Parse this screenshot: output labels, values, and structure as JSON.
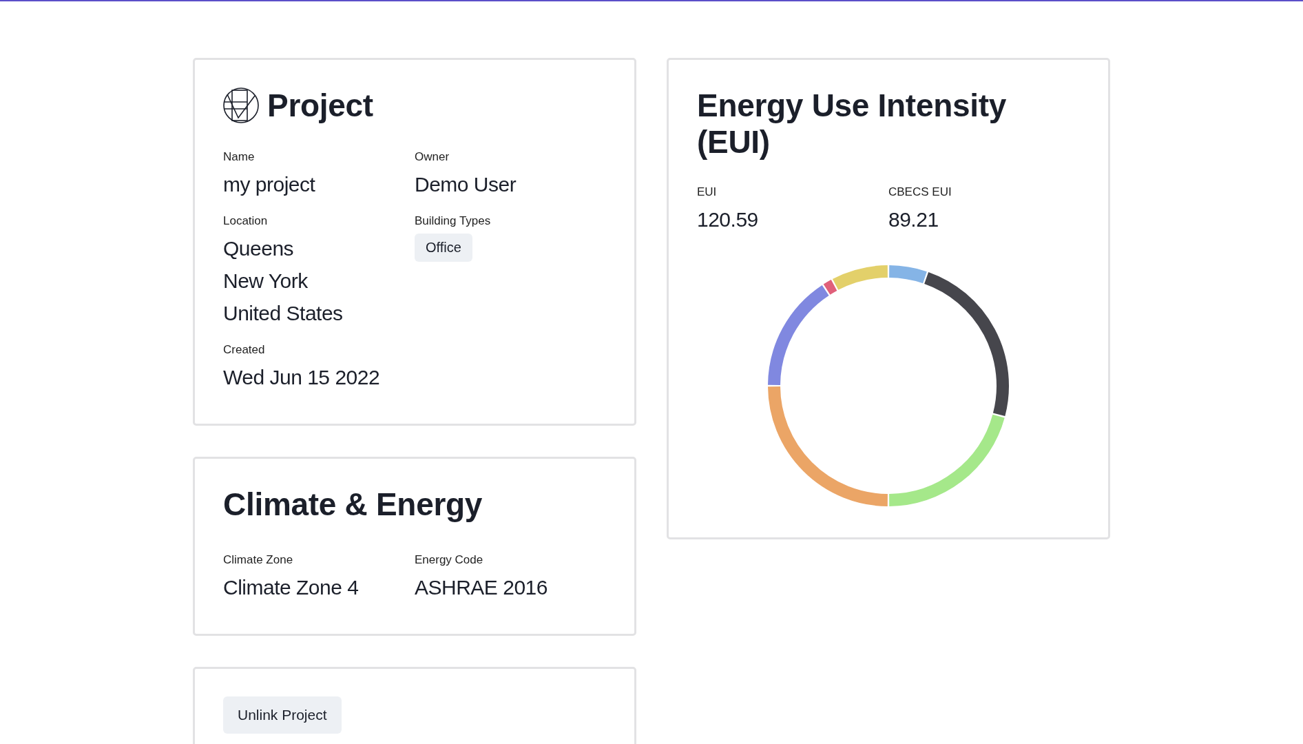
{
  "project_card": {
    "title": "Project",
    "fields": [
      {
        "label": "Name",
        "values": [
          "my project"
        ]
      },
      {
        "label": "Owner",
        "values": [
          "Demo User"
        ]
      },
      {
        "label": "Location",
        "values": [
          "Queens",
          "New York",
          "United States"
        ]
      },
      {
        "label": "Building Types",
        "tags": [
          "Office"
        ]
      },
      {
        "label": "Created",
        "values": [
          "Wed Jun 15 2022"
        ]
      }
    ]
  },
  "climate_card": {
    "title": "Climate & Energy",
    "fields": [
      {
        "label": "Climate Zone",
        "values": [
          "Climate Zone 4"
        ]
      },
      {
        "label": "Energy Code",
        "values": [
          "ASHRAE 2016"
        ]
      }
    ]
  },
  "actions_card": {
    "buttons": [
      "Unlink Project"
    ]
  },
  "eui_card": {
    "title": "Energy Use Intensity (EUI)",
    "stats": [
      {
        "label": "EUI",
        "value": "120.59"
      },
      {
        "label": "CBECS EUI",
        "value": "89.21"
      }
    ]
  }
}
